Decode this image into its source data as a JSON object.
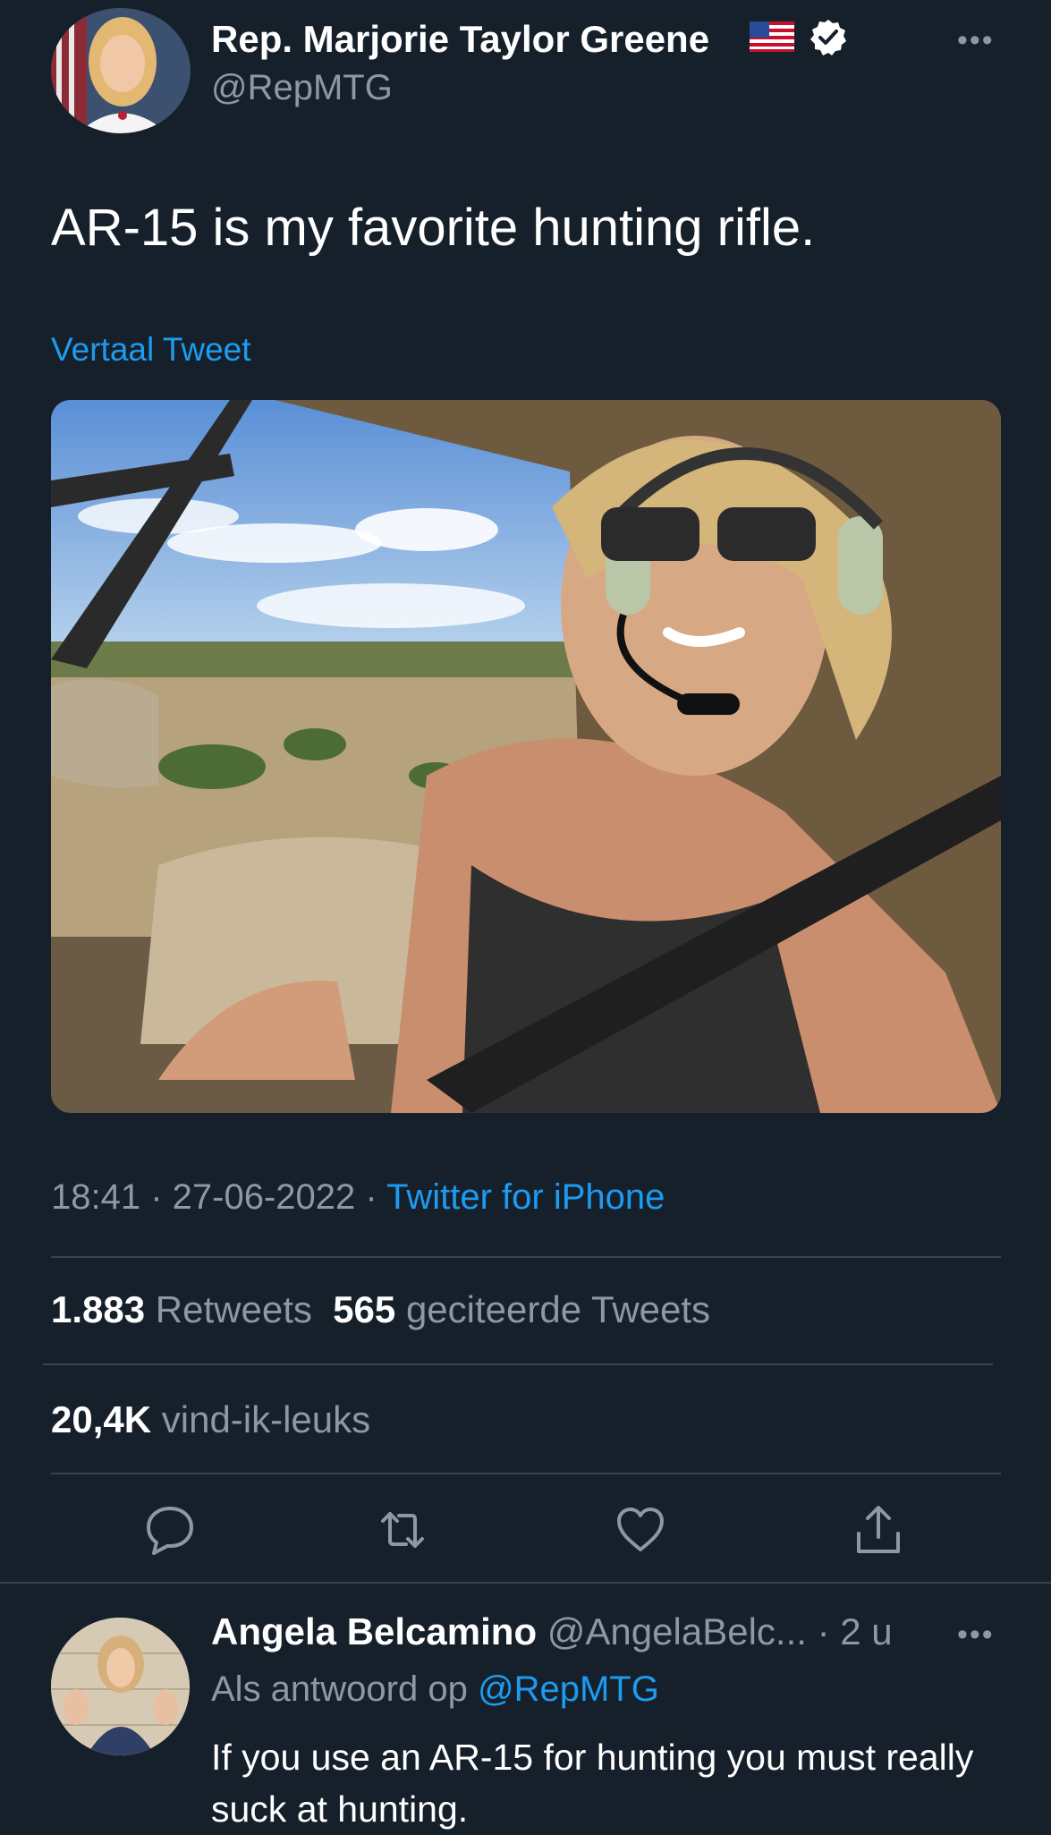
{
  "tweet": {
    "author_name": "Rep. Marjorie Taylor Greene",
    "handle": "@RepMTG",
    "text": "AR-15 is my favorite hunting rifle.",
    "translate_label": "Vertaal Tweet",
    "time": "18:41",
    "date": "27-06-2022",
    "source": "Twitter for iPhone",
    "retweets_count": "1.883",
    "retweets_label": "Retweets",
    "quotes_count": "565",
    "quotes_label": "geciteerde Tweets",
    "likes_count": "20,4K",
    "likes_label": "vind-ik-leuks",
    "more_label": "•••"
  },
  "actions": [
    "reply-icon",
    "retweet-icon",
    "like-icon",
    "share-icon"
  ],
  "reply": {
    "author_name": "Angela Belcamino",
    "handle_time": "@AngelaBelc... · 2 u",
    "replying_prefix": "Als antwoord op",
    "replying_to": "@RepMTG",
    "text": "If you use an AR-15 for hunting you must really suck at hunting.",
    "more_label": "•••"
  },
  "colors": {
    "background": "#15202b",
    "accent": "#1d9bf0",
    "secondary_text": "#8b98a5",
    "divider": "#38444d"
  }
}
